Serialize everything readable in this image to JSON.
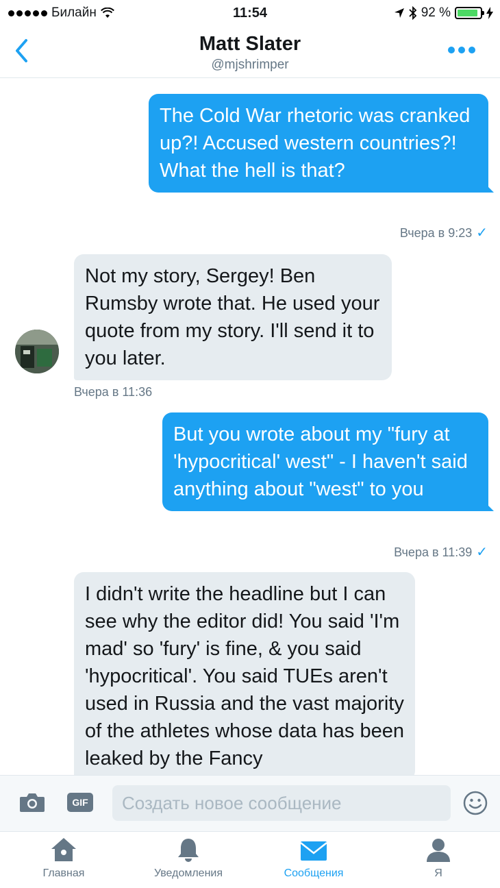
{
  "status": {
    "carrier": "Билайн",
    "time": "11:54",
    "battery": "92 %",
    "battery_level": 0.92
  },
  "header": {
    "name": "Matt Slater",
    "handle": "@mjshrimper",
    "back_icon": "chevron-left-icon",
    "more_icon": "more-dots-icon"
  },
  "messages": [
    {
      "direction": "out",
      "text": "The Cold War rhetoric was cranked up?! Accused western countries?! What the hell is that?",
      "timestamp": "Вчера в 9:23",
      "read": true
    },
    {
      "direction": "in",
      "text": "Not my story, Sergey! Ben Rumsby wrote that. He used your quote from my story. I'll send it to you later.",
      "timestamp": "Вчера в 11:36"
    },
    {
      "direction": "out",
      "text": "But you wrote about my \"fury at 'hypocritical' west\" - I haven't said anything about \"west\" to you",
      "timestamp": "Вчера в 11:39",
      "read": true
    },
    {
      "direction": "in",
      "text": "I didn't write the headline but I can see why the editor did! You said 'I'm mad' so 'fury' is fine, & you said 'hypocritical'. You said TUEs aren't used in Russia and the vast majority of the athletes whose data has been leaked by the Fancy"
    }
  ],
  "composer": {
    "gif_label": "GIF",
    "placeholder": "Создать новое сообщение",
    "icons": [
      "camera-icon",
      "gif-icon",
      "emoji-icon"
    ]
  },
  "tabs": [
    {
      "label": "Главная",
      "icon": "home-icon",
      "active": false
    },
    {
      "label": "Уведомления",
      "icon": "bell-icon",
      "active": false
    },
    {
      "label": "Сообщения",
      "icon": "envelope-icon",
      "active": true
    },
    {
      "label": "Я",
      "icon": "person-icon",
      "active": false
    }
  ],
  "colors": {
    "accent": "#1da1f2",
    "incoming_bubble": "#e6ecf0",
    "secondary_text": "#657786"
  }
}
